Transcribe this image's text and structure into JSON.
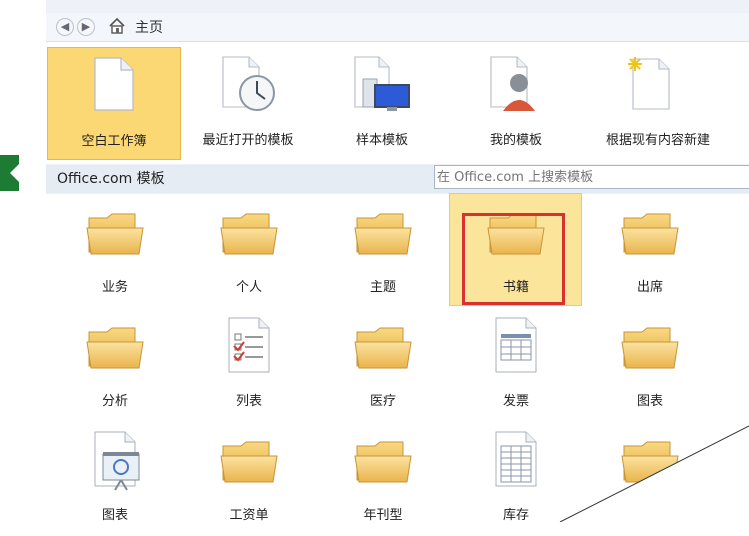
{
  "nav": {
    "back_glyph": "◀",
    "forward_glyph": "▶",
    "home_label": "主页"
  },
  "top_templates": [
    {
      "label": "空白工作簿",
      "icon": "blank-document-icon",
      "selected": true
    },
    {
      "label": "最近打开的模板",
      "icon": "recent-templates-icon",
      "selected": false
    },
    {
      "label": "样本模板",
      "icon": "sample-templates-icon",
      "selected": false
    },
    {
      "label": "我的模板",
      "icon": "my-templates-icon",
      "selected": false
    },
    {
      "label": "根据现有内容新建",
      "icon": "new-from-existing-icon",
      "selected": false
    }
  ],
  "office_section": {
    "title": "Office.com 模板",
    "search_placeholder": "在 Office.com 上搜索模板"
  },
  "grid": [
    {
      "label": "业务",
      "icon": "folder-icon"
    },
    {
      "label": "个人",
      "icon": "folder-icon"
    },
    {
      "label": "主题",
      "icon": "folder-icon"
    },
    {
      "label": "书籍",
      "icon": "folder-icon",
      "highlighted": true
    },
    {
      "label": "出席",
      "icon": "folder-icon"
    },
    {
      "label": "分析",
      "icon": "folder-icon"
    },
    {
      "label": "列表",
      "icon": "checklist-icon"
    },
    {
      "label": "医疗",
      "icon": "folder-icon"
    },
    {
      "label": "发票",
      "icon": "invoice-icon"
    },
    {
      "label": "图表",
      "icon": "folder-icon"
    },
    {
      "label": "图表",
      "icon": "presentation-chart-icon"
    },
    {
      "label": "工资单",
      "icon": "folder-icon"
    },
    {
      "label": "年刊型",
      "icon": "folder-icon"
    },
    {
      "label": "库存",
      "icon": "spreadsheet-icon"
    },
    {
      "label": "",
      "icon": "folder-icon"
    }
  ],
  "colors": {
    "selected_tile": "#fbd874",
    "highlight": "#fbe59a",
    "red_annotation": "#d9322e",
    "green_tab": "#1e7b34"
  }
}
